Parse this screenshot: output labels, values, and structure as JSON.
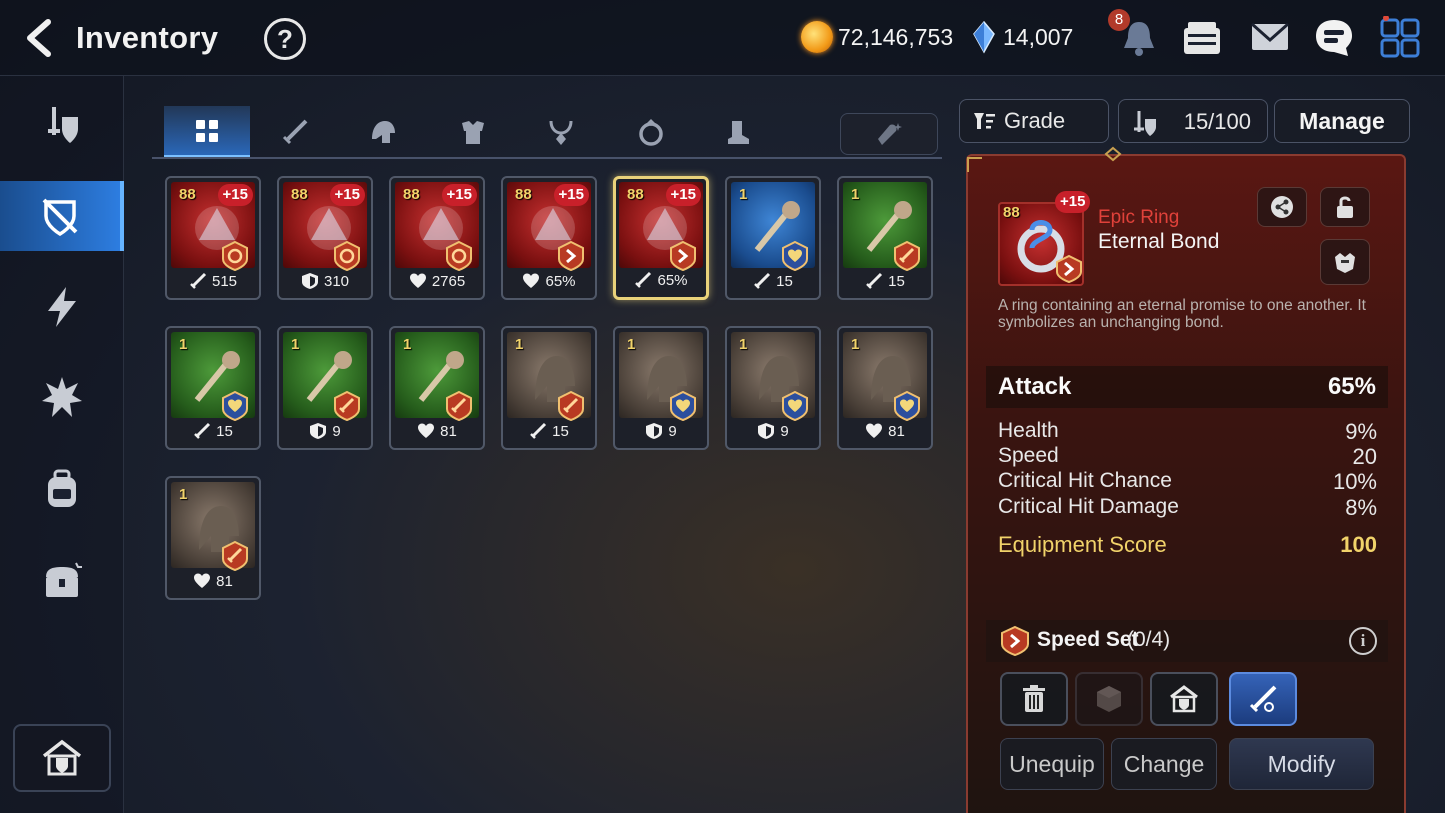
{
  "header": {
    "title": "Inventory",
    "gold": "72,146,753",
    "crystals": "14,007",
    "notification_count": "8"
  },
  "tabs": [
    {
      "icon": "grid-icon",
      "active": true
    },
    {
      "icon": "sword-icon"
    },
    {
      "icon": "helmet-icon"
    },
    {
      "icon": "armor-icon"
    },
    {
      "icon": "necklace-icon"
    },
    {
      "icon": "ring-icon"
    },
    {
      "icon": "boots-icon"
    }
  ],
  "items": [
    {
      "level": "88",
      "enh": "+15",
      "rarity": "red",
      "stat_icon": "attack-icon",
      "stat": "515",
      "set_icon": "gear-set-icon"
    },
    {
      "level": "88",
      "enh": "+15",
      "rarity": "red",
      "stat_icon": "defense-icon",
      "stat": "310",
      "set_icon": "gear-set-icon"
    },
    {
      "level": "88",
      "enh": "+15",
      "rarity": "red",
      "stat_icon": "health-icon",
      "stat": "2765",
      "set_icon": "gear-set-icon"
    },
    {
      "level": "88",
      "enh": "+15",
      "rarity": "red",
      "stat_icon": "health-icon",
      "stat": "65%",
      "set_icon": "speed-set-icon"
    },
    {
      "level": "88",
      "enh": "+15",
      "rarity": "red",
      "stat_icon": "attack-icon",
      "stat": "65%",
      "set_icon": "speed-set-icon",
      "selected": true
    },
    {
      "level": "1",
      "enh": "",
      "rarity": "blue",
      "stat_icon": "attack-icon",
      "stat": "15",
      "set_icon": "heart-set-icon"
    },
    {
      "level": "1",
      "enh": "",
      "rarity": "green",
      "stat_icon": "attack-icon",
      "stat": "15",
      "set_icon": "attack-set-icon"
    },
    {
      "level": "1",
      "enh": "",
      "rarity": "green",
      "stat_icon": "attack-icon",
      "stat": "15",
      "set_icon": "heart-set-icon"
    },
    {
      "level": "1",
      "enh": "",
      "rarity": "green",
      "stat_icon": "defense-icon",
      "stat": "9",
      "set_icon": "attack-set-icon"
    },
    {
      "level": "1",
      "enh": "",
      "rarity": "green",
      "stat_icon": "health-icon",
      "stat": "81",
      "set_icon": "attack-set-icon"
    },
    {
      "level": "1",
      "enh": "",
      "rarity": "gray",
      "stat_icon": "attack-icon",
      "stat": "15",
      "set_icon": "attack-set-icon"
    },
    {
      "level": "1",
      "enh": "",
      "rarity": "gray",
      "stat_icon": "defense-icon",
      "stat": "9",
      "set_icon": "heart-set-icon"
    },
    {
      "level": "1",
      "enh": "",
      "rarity": "gray",
      "stat_icon": "defense-icon",
      "stat": "9",
      "set_icon": "heart-set-icon"
    },
    {
      "level": "1",
      "enh": "",
      "rarity": "gray",
      "stat_icon": "health-icon",
      "stat": "81",
      "set_icon": "heart-set-icon"
    },
    {
      "level": "1",
      "enh": "",
      "rarity": "gray",
      "stat_icon": "health-icon",
      "stat": "81",
      "set_icon": "attack-set-icon"
    }
  ],
  "controls": {
    "grade_label": "Grade",
    "capacity": "15/100",
    "manage_label": "Manage"
  },
  "detail": {
    "level": "88",
    "enh": "+15",
    "rarity": "Epic Ring",
    "name": "Eternal Bond",
    "description": "A ring containing an eternal promise to one another. It symbolizes an unchanging bond.",
    "main_stat": {
      "name": "Attack",
      "value": "65%"
    },
    "sub_stats": [
      {
        "name": "Health",
        "value": "9%"
      },
      {
        "name": "Speed",
        "value": "20"
      },
      {
        "name": "Critical Hit Chance",
        "value": "10%"
      },
      {
        "name": "Critical Hit Damage",
        "value": "8%"
      }
    ],
    "score": {
      "name": "Equipment Score",
      "value": "100"
    },
    "set": {
      "name": "Speed Set",
      "count": "(0/4)"
    },
    "buttons": {
      "unequip": "Unequip",
      "change": "Change",
      "modify": "Modify"
    }
  },
  "colors": {
    "accent_blue": "#2d7de0",
    "epic_red": "#e0413a",
    "score_gold": "#f1d36a",
    "enhance_badge": "#c8202a"
  }
}
